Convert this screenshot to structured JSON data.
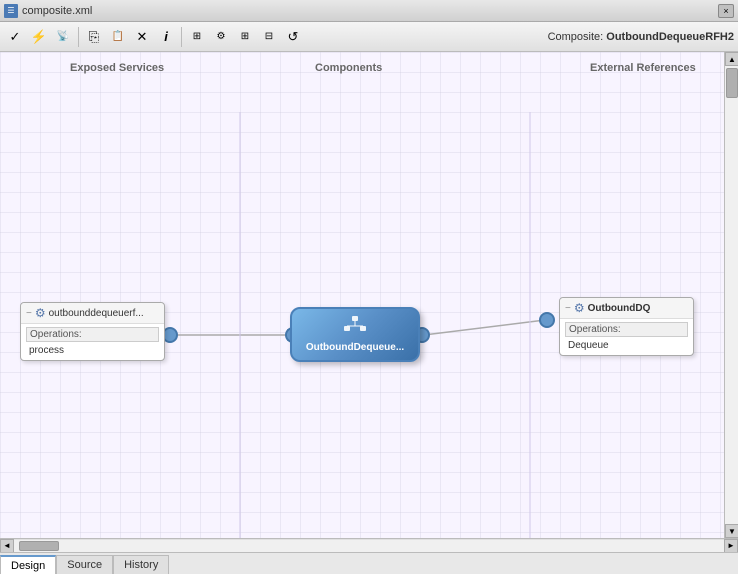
{
  "titlebar": {
    "icon": "☰",
    "filename": "composite.xml",
    "close_label": "×"
  },
  "toolbar": {
    "composite_label": "Composite:",
    "composite_name": "OutboundDequeueRFH2",
    "buttons": [
      {
        "name": "check-btn",
        "icon": "✓",
        "label": "Validate"
      },
      {
        "name": "lightning-btn",
        "icon": "⚡",
        "label": "Run"
      },
      {
        "name": "signal-btn",
        "icon": "📶",
        "label": "Signal"
      },
      {
        "name": "copy-btn",
        "icon": "⎘",
        "label": "Copy"
      },
      {
        "name": "paste-btn",
        "icon": "📋",
        "label": "Paste"
      },
      {
        "name": "delete-btn",
        "icon": "✕",
        "label": "Delete"
      },
      {
        "name": "info-btn",
        "icon": "ℹ",
        "label": "Info"
      },
      {
        "name": "view-btn",
        "icon": "👁",
        "label": "View"
      },
      {
        "name": "props-btn",
        "icon": "⚙",
        "label": "Properties"
      },
      {
        "name": "expand-btn",
        "icon": "⊞",
        "label": "Expand"
      },
      {
        "name": "collapse-btn",
        "icon": "⊟",
        "label": "Collapse"
      },
      {
        "name": "refresh-btn",
        "icon": "↺",
        "label": "Refresh"
      }
    ]
  },
  "columns": {
    "exposed_services": "Exposed Services",
    "components": "Components",
    "external_references": "External References"
  },
  "service_node": {
    "icon": "⚙",
    "name": "outbounddequeuerf...",
    "operations_label": "Operations:",
    "operations": [
      "process"
    ]
  },
  "component_node": {
    "icon": "✦",
    "name": "OutboundDequeue..."
  },
  "ext_ref_node": {
    "icon": "⚙",
    "name": "OutboundDQ",
    "operations_label": "Operations:",
    "operations": [
      "Dequeue"
    ]
  },
  "tabs": [
    {
      "label": "Design",
      "active": true
    },
    {
      "label": "Source",
      "active": false
    },
    {
      "label": "History",
      "active": false
    }
  ]
}
